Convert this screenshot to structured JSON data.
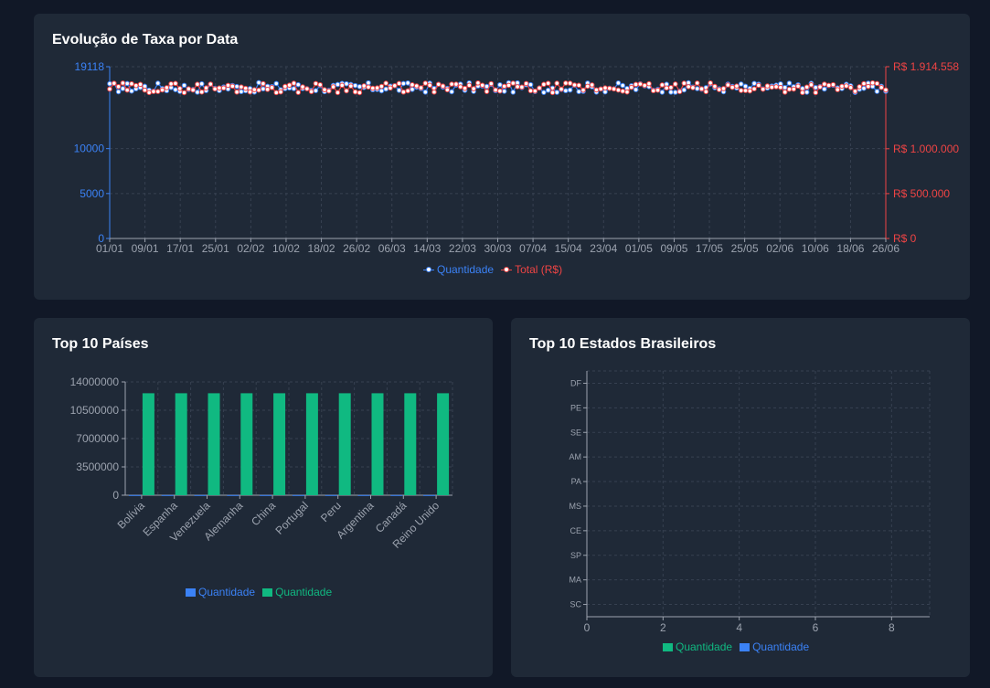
{
  "colors": {
    "background": "#111827",
    "card": "#1f2937",
    "quantidade_blue": "#3b82f6",
    "total_red": "#ef4444",
    "green": "#10b981",
    "grid": "#374151",
    "axis_text": "#9ca3af"
  },
  "line_card": {
    "title": "Evolução de Taxa por Data",
    "legend": [
      "Quantidade",
      "Total (R$)"
    ]
  },
  "countries_card": {
    "title": "Top 10 Países",
    "legend": [
      "Quantidade",
      "Quantidade"
    ]
  },
  "states_card": {
    "title": "Top 10 Estados Brasileiros",
    "legend": [
      "Quantidade",
      "Quantidade"
    ]
  },
  "chart_data": [
    {
      "type": "line",
      "title": "Evolução de Taxa por Data",
      "x_tick_labels": [
        "01/01",
        "09/01",
        "17/01",
        "25/01",
        "02/02",
        "10/02",
        "18/02",
        "26/02",
        "06/03",
        "14/03",
        "22/03",
        "30/03",
        "07/04",
        "15/04",
        "23/04",
        "01/05",
        "09/05",
        "17/05",
        "25/05",
        "02/06",
        "10/06",
        "18/06",
        "26/06"
      ],
      "x_range": [
        "01/01",
        "26/06"
      ],
      "points_per_series": 178,
      "left_axis": {
        "ticks": [
          "0",
          "5000",
          "10000",
          "19118"
        ],
        "ylim": [
          0,
          19118
        ]
      },
      "right_axis": {
        "ticks": [
          "R$ 0",
          "R$ 500.000",
          "R$ 1.000.000",
          "R$ 1.914.558"
        ],
        "ylim": [
          0,
          1914558
        ]
      },
      "series": [
        {
          "name": "Quantidade",
          "axis": "left",
          "approx_value": 16800,
          "range": [
            16300,
            17400
          ],
          "color": "#3b82f6"
        },
        {
          "name": "Total (R$)",
          "axis": "right",
          "approx_value": 1680000,
          "range": [
            1630000,
            1740000
          ],
          "color": "#ef4444"
        }
      ],
      "grid": true,
      "legend_position": "bottom"
    },
    {
      "type": "bar",
      "title": "Top 10 Países",
      "categories": [
        "Bolívia",
        "Espanha",
        "Venezuela",
        "Alemanha",
        "China",
        "Portugal",
        "Peru",
        "Argentina",
        "Canadá",
        "Reino Unido"
      ],
      "y_ticks": [
        "0",
        "3500000",
        "7000000",
        "10500000",
        "14000000"
      ],
      "ylim": [
        0,
        14000000
      ],
      "series": [
        {
          "name": "Quantidade",
          "color": "#3b82f6",
          "values": [
            20000,
            20000,
            20000,
            20000,
            20000,
            20000,
            20000,
            20000,
            20000,
            20000
          ]
        },
        {
          "name": "Quantidade",
          "color": "#10b981",
          "values": [
            12600000,
            12600000,
            12600000,
            12600000,
            12600000,
            12600000,
            12600000,
            12600000,
            12600000,
            12600000
          ]
        }
      ],
      "grid": true,
      "legend_position": "bottom"
    },
    {
      "type": "bar",
      "orientation": "horizontal",
      "title": "Top 10 Estados Brasileiros",
      "categories": [
        "DF",
        "PE",
        "SE",
        "AM",
        "PA",
        "MS",
        "CE",
        "SP",
        "MA",
        "SC"
      ],
      "x_ticks": [
        "0",
        "2",
        "4",
        "6",
        "8"
      ],
      "xlim": [
        0,
        9
      ],
      "series": [
        {
          "name": "Quantidade",
          "color": "#10b981",
          "values": [
            0,
            0,
            0,
            0,
            0,
            0,
            0,
            0,
            0,
            0
          ]
        },
        {
          "name": "Quantidade",
          "color": "#3b82f6",
          "values": [
            0,
            0,
            0,
            0,
            0,
            0,
            0,
            0,
            0,
            0
          ]
        }
      ],
      "grid": true,
      "legend_position": "bottom"
    }
  ]
}
